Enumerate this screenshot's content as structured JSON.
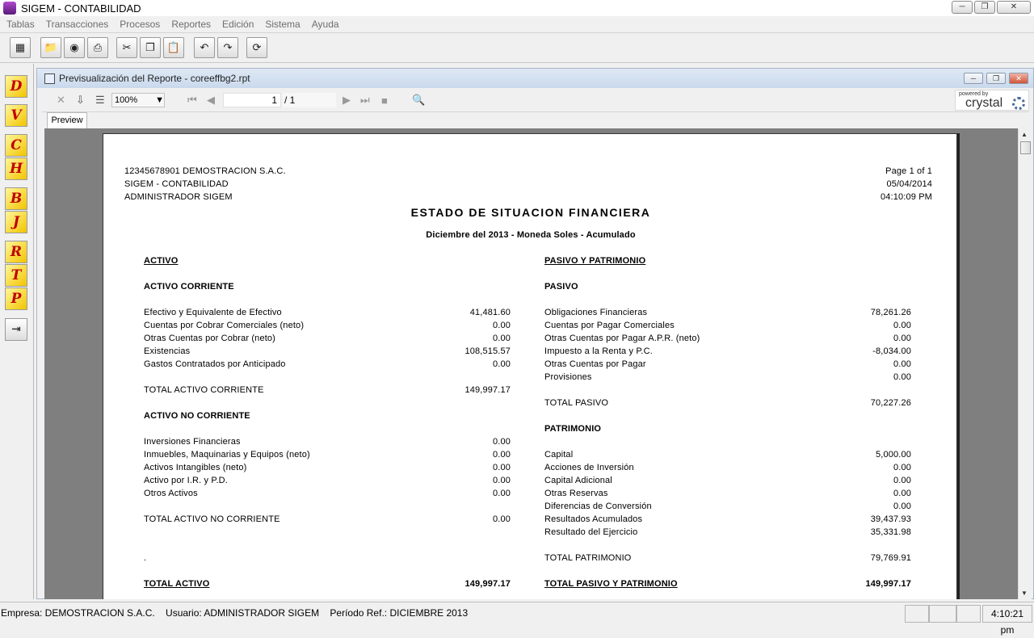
{
  "window": {
    "title": "SIGEM - CONTABILIDAD"
  },
  "menu": [
    "Tablas",
    "Transacciones",
    "Procesos",
    "Reportes",
    "Edición",
    "Sistema",
    "Ayuda"
  ],
  "left_toolbar": [
    "D",
    "V",
    "C",
    "H",
    "B",
    "J",
    "R",
    "T",
    "P"
  ],
  "report_window": {
    "title": "Previsualización del Reporte - coreeffbg2.rpt",
    "zoom": "100%",
    "page_current": "1",
    "page_total": "/ 1",
    "tab": "Preview",
    "powered_by": "powered by",
    "brand": "crystal"
  },
  "report": {
    "header_left": [
      "12345678901 DEMOSTRACION S.A.C.",
      "SIGEM - CONTABILIDAD",
      "ADMINISTRADOR SIGEM"
    ],
    "header_right": [
      "Page 1 of 1",
      "05/04/2014",
      "04:10:09 PM"
    ],
    "title": "ESTADO DE SITUACION FINANCIERA",
    "subtitle": "Diciembre del 2013 - Moneda Soles - Acumulado",
    "left": {
      "section": "ACTIVO",
      "current_heading": "ACTIVO CORRIENTE",
      "current_items": [
        {
          "label": "Efectivo y Equivalente de Efectivo",
          "value": "41,481.60"
        },
        {
          "label": "Cuentas por Cobrar Comerciales (neto)",
          "value": "0.00"
        },
        {
          "label": "Otras Cuentas por Cobrar (neto)",
          "value": "0.00"
        },
        {
          "label": "Existencias",
          "value": "108,515.57"
        },
        {
          "label": "Gastos Contratados por Anticipado",
          "value": "0.00"
        }
      ],
      "current_total_label": "TOTAL ACTIVO CORRIENTE",
      "current_total": "149,997.17",
      "noncurrent_heading": "ACTIVO NO CORRIENTE",
      "noncurrent_items": [
        {
          "label": "Inversiones Financieras",
          "value": "0.00"
        },
        {
          "label": "Inmuebles, Maquinarias y Equipos (neto)",
          "value": "0.00"
        },
        {
          "label": "Activos Intangibles (neto)",
          "value": "0.00"
        },
        {
          "label": "Activo por I.R. y P.D.",
          "value": "0.00"
        },
        {
          "label": "Otros Activos",
          "value": "0.00"
        }
      ],
      "noncurrent_total_label": "TOTAL ACTIVO NO CORRIENTE",
      "noncurrent_total": "0.00",
      "dot": ".",
      "grand_total_label": "TOTAL ACTIVO",
      "grand_total": "149,997.17"
    },
    "right": {
      "section": "PASIVO Y PATRIMONIO",
      "liab_heading": "PASIVO",
      "liab_items": [
        {
          "label": "Obligaciones Financieras",
          "value": "78,261.26"
        },
        {
          "label": "Cuentas por Pagar Comerciales",
          "value": "0.00"
        },
        {
          "label": "Otras Cuentas por Pagar A.P.R. (neto)",
          "value": "0.00"
        },
        {
          "label": "Impuesto a la Renta y P.C.",
          "value": "-8,034.00"
        },
        {
          "label": "Otras Cuentas por Pagar",
          "value": "0.00"
        },
        {
          "label": "Provisiones",
          "value": "0.00"
        }
      ],
      "liab_total_label": "TOTAL PASIVO",
      "liab_total": "70,227.26",
      "equity_heading": "PATRIMONIO",
      "equity_items": [
        {
          "label": "Capital",
          "value": "5,000.00"
        },
        {
          "label": "Acciones de Inversión",
          "value": "0.00"
        },
        {
          "label": "Capital Adicional",
          "value": "0.00"
        },
        {
          "label": "Otras Reservas",
          "value": "0.00"
        },
        {
          "label": "Diferencias de Conversión",
          "value": "0.00"
        },
        {
          "label": "Resultados Acumulados",
          "value": "39,437.93"
        },
        {
          "label": "Resultado del Ejercicio",
          "value": "35,331.98"
        }
      ],
      "equity_total_label": "TOTAL PATRIMONIO",
      "equity_total": "79,769.91",
      "grand_total_label": "TOTAL PASIVO Y PATRIMONIO",
      "grand_total": "149,997.17"
    }
  },
  "status": {
    "text": "Empresa: DEMOSTRACION S.A.C.    Usuario: ADMINISTRADOR SIGEM    Período Ref.: DICIEMBRE 2013",
    "time": "4:10:21 pm"
  }
}
